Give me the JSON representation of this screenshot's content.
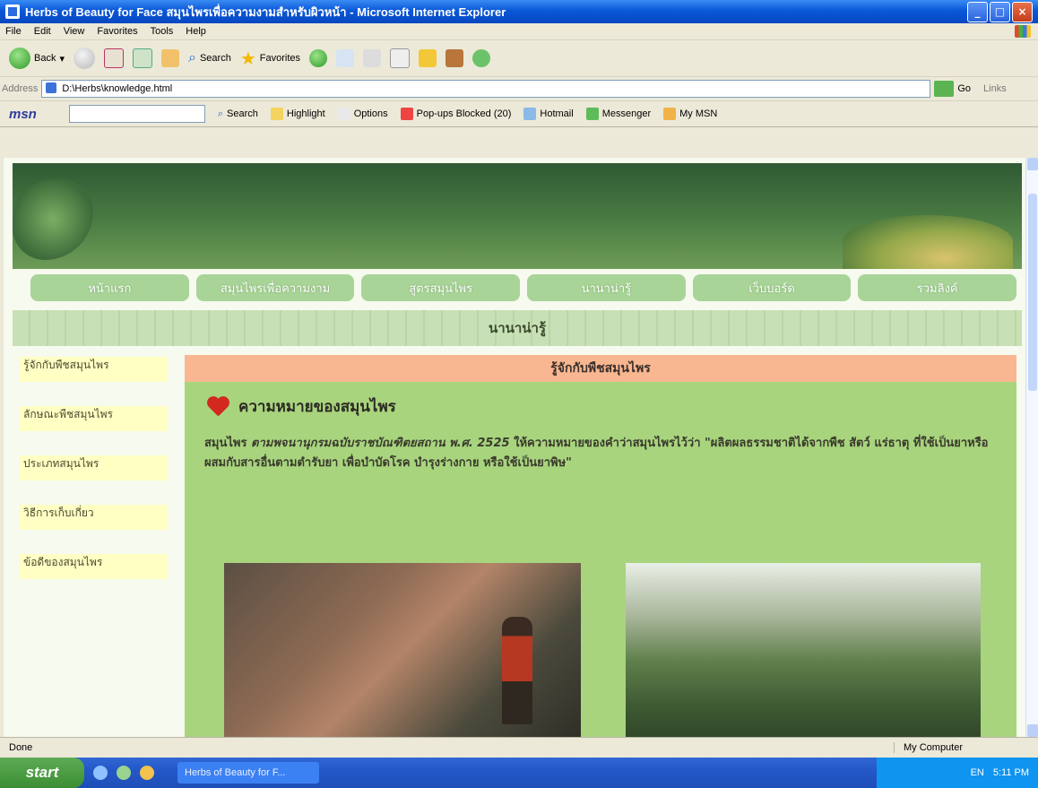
{
  "window": {
    "title": "Herbs of Beauty for Face สมุนไพรเพื่อความงามสำหรับผิวหน้า - Microsoft Internet Explorer",
    "controls": {
      "minimize": "_",
      "maximize": "□",
      "close": "×"
    }
  },
  "menu": [
    "File",
    "Edit",
    "View",
    "Favorites",
    "Tools",
    "Help"
  ],
  "toolbar": {
    "back": "Back",
    "search": "Search",
    "favorites": "Favorites"
  },
  "address": {
    "label": "Address",
    "value": "D:\\Herbs\\knowledge.html",
    "go": "Go",
    "links": "Links"
  },
  "msn": {
    "logo": "msn",
    "search": "Search",
    "highlight": "Highlight",
    "options": "Options",
    "popups": "Pop-ups Blocked (20)",
    "hotmail": "Hotmail",
    "messenger": "Messenger",
    "mymsn": "My MSN"
  },
  "page": {
    "nav": [
      "หน้าแรก",
      "สมุนไพรเพื่อความงาม",
      "สูตรสมุนไพร",
      "นานาน่ารู้",
      "เว็บบอร์ด",
      "รวมลิงค์"
    ],
    "section_title": "นานาน่ารู้",
    "sidebar": [
      "รู้จักกับพืชสมุนไพร",
      "ลักษณะพืชสมุนไพร",
      "ประเภทสมุนไพร",
      "วิธีการเก็บเกี่ยว",
      "ข้อดีของสมุนไพร"
    ],
    "content_title": "รู้จักกับพืชสมุนไพร",
    "heading": "ความหมายของสมุนไพร",
    "para_lead": "สมุนไพร",
    "para_ref": "ตามพจนานุกรมฉบับราชบัณฑิตยสถาน พ.ศ. 2525",
    "para_rest": "ให้ความหมายของคำว่าสมุนไพรไว้ว่า \"ผลิตผลธรรมชาติได้จากพืช สัตว์ แร่ธาตุ ที่ใช้เป็นยาหรือผสมกับสารอื่นตามตำรับยา เพื่อบำบัดโรค บำรุงร่างกาย หรือใช้เป็นยาพิษ\""
  },
  "status": {
    "text": "Done",
    "zone": "My Computer"
  },
  "taskbar": {
    "start": "start",
    "task": "Herbs of Beauty for F...",
    "lang": "EN",
    "time": "5:11 PM"
  },
  "colors": {
    "nav_green": "#A9D498",
    "content_green": "#A8D47E",
    "header_peach": "#F8B790",
    "sidebar_yellow": "#FFFFC4",
    "heart_red": "#D2281F"
  }
}
